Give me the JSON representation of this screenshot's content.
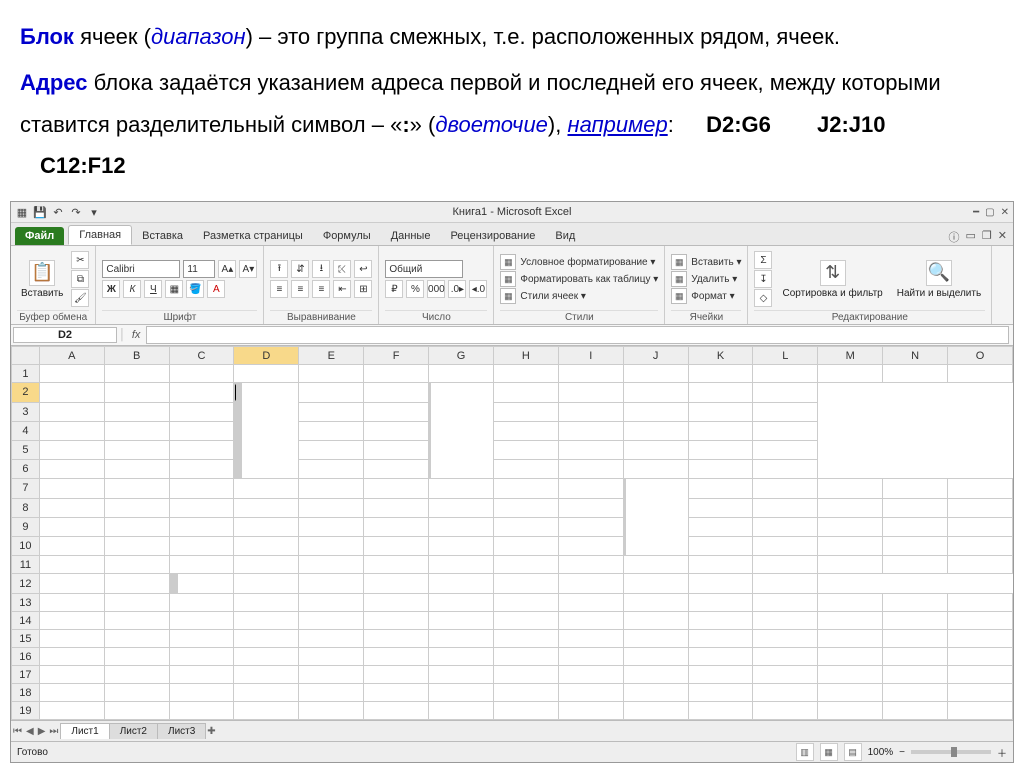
{
  "text": {
    "p1a": "Блок",
    "p1b": " ячеек (",
    "p1c": "диапазон",
    "p1d": ") – это группа смежных, т.е. расположенных рядом, ячеек.",
    "p2a": "Адрес",
    "p2b": " блока задаётся указанием адреса первой и последней его ячеек, между которыми ставится разделительный символ – «",
    "p2c": ":",
    "p2d": "» (",
    "p2e": "двоеточие",
    "p2f": "), ",
    "p2g": "например",
    "p2h": ":",
    "ex1": "D2:G6",
    "ex2": "J2:J10",
    "ex3": "C12:F12"
  },
  "excel": {
    "title": "Книга1 - Microsoft Excel",
    "file": "Файл",
    "tabs": [
      "Главная",
      "Вставка",
      "Разметка страницы",
      "Формулы",
      "Данные",
      "Рецензирование",
      "Вид"
    ],
    "groups": {
      "clipboard": "Буфер обмена",
      "paste": "Вставить",
      "font": "Шрифт",
      "fontname": "Calibri",
      "fontsize": "11",
      "align": "Выравнивание",
      "number": "Число",
      "numfmt": "Общий",
      "styles": "Стили",
      "s1": "Условное форматирование ▾",
      "s2": "Форматировать как таблицу ▾",
      "s3": "Стили ячеек ▾",
      "cells": "Ячейки",
      "c1": "Вставить ▾",
      "c2": "Удалить ▾",
      "c3": "Формат ▾",
      "edit": "Редактирование",
      "e1": "Сортировка и фильтр",
      "e2": "Найти и выделить"
    },
    "namebox": "D2",
    "cols": [
      "A",
      "B",
      "C",
      "D",
      "E",
      "F",
      "G",
      "H",
      "I",
      "J",
      "K",
      "L",
      "M",
      "N",
      "O"
    ],
    "rows": [
      "1",
      "2",
      "3",
      "4",
      "5",
      "6",
      "7",
      "8",
      "9",
      "10",
      "11",
      "12",
      "13",
      "14",
      "15",
      "16",
      "17",
      "18",
      "19"
    ],
    "sheets": [
      "Лист1",
      "Лист2",
      "Лист3"
    ],
    "status": "Готово",
    "zoom": "100%"
  }
}
